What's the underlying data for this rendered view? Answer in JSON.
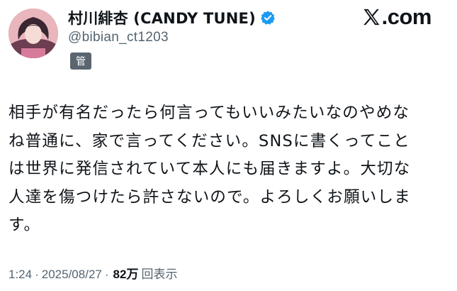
{
  "author": {
    "display_name": "村川緋杏 (CANDY TUNE)",
    "handle": "@bibian_ct1203",
    "badge": "管",
    "verified_icon": "verified-badge-icon",
    "avatar_icon": "profile-avatar"
  },
  "brand": {
    "logo_icon": "x-logo-icon",
    "text": ".com",
    "color": "#0f1419"
  },
  "tweet": {
    "text": "相手が有名だったら何言ってもいいみたいなのやめな\nね普通に、家で言ってください。SNSに書くってこと\nは世界に発信されていて本人にも届きますよ。大切な\n人達を傷つけたら許さないので。よろしくお願いしま\nす。"
  },
  "meta": {
    "time": "1:24",
    "sep1": "·",
    "date": "2025/08/27",
    "sep2": "·",
    "views_count": "82万",
    "views_label": "回表示"
  },
  "colors": {
    "text_primary": "#0f1419",
    "text_secondary": "#536471",
    "verified_blue": "#1d9bf0",
    "badge_bg": "#5b6570"
  }
}
